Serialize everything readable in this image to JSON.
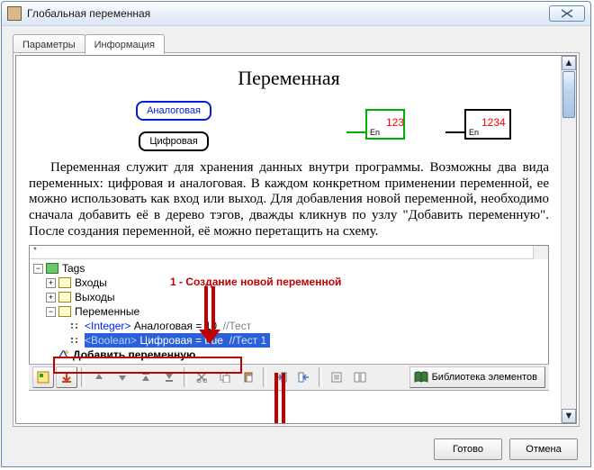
{
  "window": {
    "title": "Глобальная переменная"
  },
  "tabs": {
    "t0": "Параметры",
    "t1": "Информация"
  },
  "heading": "Переменная",
  "pills": {
    "analog": "Аналоговая",
    "digital": "Цифровая"
  },
  "blocks": {
    "green": {
      "value": "123",
      "en": "En"
    },
    "black": {
      "value": "1234",
      "en": "En"
    }
  },
  "prose": "Переменная служит для хранения данных внутри программы. Возможны два вида переменных: цифровая и аналоговая. В каждом конкретном применении переменной, ее можно использовать как вход или выход. Для добавления новой переменной, необходимо сначала добавить её в дерево тэгов, дважды кликнув по узлу \"Добавить переменную\". После создания переменной, её можно перетащить на схему.",
  "annot": {
    "step1": "1 - Создание новой переменной"
  },
  "tree": {
    "root": "Tags",
    "n1": "Входы",
    "n2": "Выходы",
    "n3": "Переменные",
    "v1": {
      "type": "<Integer>",
      "name": "Аналоговая = 10",
      "comment": "//Тест"
    },
    "v2": {
      "type": "<Boolean>",
      "name": "Цифровая = true",
      "comment": "//Тест 1"
    },
    "add": "Добавить переменную"
  },
  "toolbar": {
    "lib": "Библиотека элементов"
  },
  "footer": {
    "ok": "Готово",
    "cancel": "Отмена"
  }
}
